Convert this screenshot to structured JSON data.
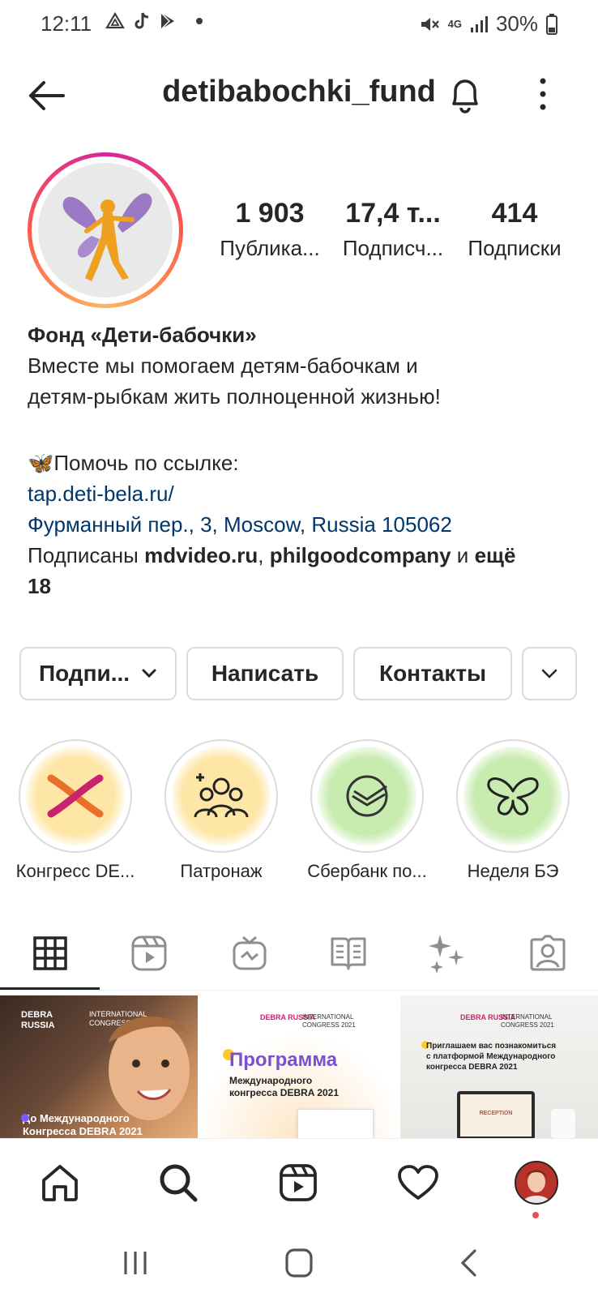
{
  "status_bar": {
    "time": "12:11",
    "battery": "30%",
    "network": "4G"
  },
  "header": {
    "username": "detibabochki_fund"
  },
  "stats": [
    {
      "value": "1 903",
      "label": "Публика..."
    },
    {
      "value": "17,4 т...",
      "label": "Подписч..."
    },
    {
      "value": "414",
      "label": "Подписки"
    }
  ],
  "bio": {
    "name": "Фонд «Дети-бабочки»",
    "line1": "Вместе мы помогаем детям-бабочкам и",
    "line2": "детям-рыбкам жить полноценной жизнью!",
    "help": "🦋Помочь по ссылке:",
    "link": "tap.deti-bela.ru/",
    "address": "Фурманный пер., 3, Moscow, Russia 105062",
    "followed_prefix": "Подписаны ",
    "followed_user1": "mdvideo.ru",
    "comma": ", ",
    "followed_user2": "philgoodcompany",
    "and": " и ",
    "more": "ещё",
    "more_count": "18"
  },
  "buttons": {
    "follow": "Подпи...",
    "message": "Написать",
    "contacts": "Контакты"
  },
  "highlights": [
    {
      "label": "Конгресс DE..."
    },
    {
      "label": "Патронаж"
    },
    {
      "label": "Сбербанк по..."
    },
    {
      "label": "Неделя БЭ"
    }
  ],
  "posts": [
    {
      "logo": "DEBRA RUSSIA",
      "congress": "INTERNATIONAL CONGRESS 2021",
      "caption": "До Международного",
      "caption2": "Конгресса DEBRA 2021"
    },
    {
      "logo": "DEBRA RUSSIA",
      "congress": "INTERNATIONAL CONGRESS 2021",
      "title": "Программа",
      "subtitle": "Международного",
      "subtitle2": "конгресса DEBRA 2021"
    },
    {
      "logo": "DEBRA RUSSIA",
      "congress": "INTERNATIONAL CONGRESS 2021",
      "caption": "Приглашаем вас познакомиться",
      "caption2": "с платформой Международного",
      "caption3": "конгресса DEBRA 2021",
      "screen_text": "RECEPTION"
    }
  ],
  "colors": {
    "link": "#00376b",
    "text": "#262626",
    "border": "#dbdbdb",
    "notif_dot": "#ed4956"
  }
}
